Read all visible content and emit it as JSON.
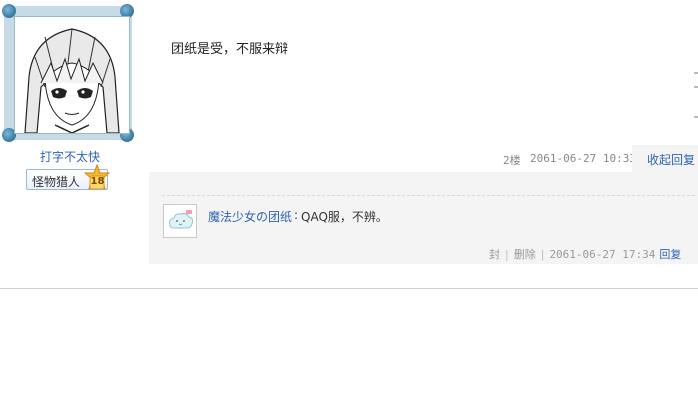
{
  "author": {
    "username": "打字不太快",
    "level_name": "怪物猎人",
    "level": "18",
    "avatar_icon": "manga-girl-avatar"
  },
  "post": {
    "content": "团纸是受，不服来辩",
    "floor": "2楼",
    "time": "2061-06-27 10:33",
    "collapse_label": "收起回复"
  },
  "reply": {
    "avatar_icon": "cloud-face-avatar",
    "author": "魔法少女の团纸",
    "colon": ":",
    "text": "QAQ服，不辨。",
    "block_label": "封",
    "delete_label": "删除",
    "time": "2061-06-27 17:34",
    "reply_label": "回复"
  },
  "colors": {
    "link": "#2d64b3",
    "reply_bg": "#f4f4f4",
    "badge_star": "#f5b72b"
  }
}
